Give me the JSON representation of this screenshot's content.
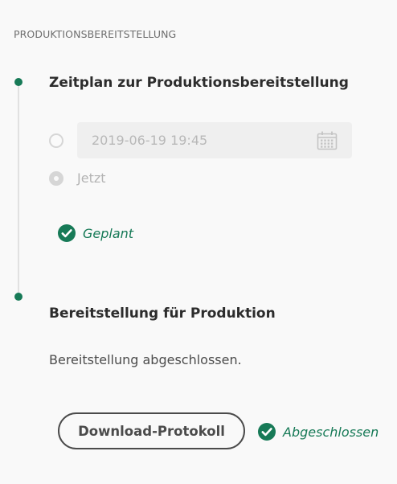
{
  "section": {
    "title": "PRODUKTIONSBEREITSTELLUNG"
  },
  "schedule_step": {
    "title": "Zeitplan zur Produktionsbereitstellung",
    "datetime_value": "2019-06-19 19:45",
    "now_label": "Jetzt",
    "status": "Geplant",
    "calendar_icon": "calendar-icon",
    "status_icon": "check-circle-icon"
  },
  "deploy_step": {
    "title": "Bereitstellung für Produktion",
    "message": "Bereitstellung abgeschlossen.",
    "download_label": "Download-Protokoll",
    "status": "Abgeschlossen",
    "status_icon": "check-circle-icon"
  },
  "colors": {
    "accent": "#177a57",
    "text": "#2c2c2c",
    "muted": "#b3b3b3",
    "field_bg": "#efefef"
  }
}
